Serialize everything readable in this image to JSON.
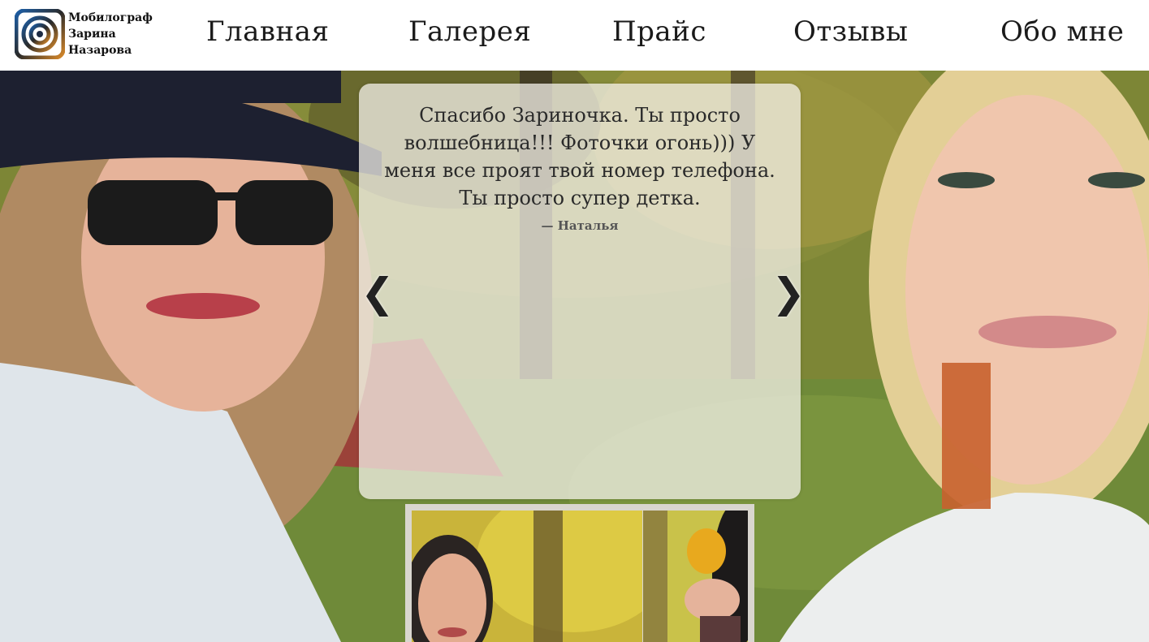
{
  "logo": {
    "line1": "Мобилограф",
    "line2": "Зарина",
    "line3": "Назарова",
    "icon": "concentric-rings-logo-icon"
  },
  "nav": {
    "items": [
      {
        "label": "Главная"
      },
      {
        "label": "Галерея"
      },
      {
        "label": "Прайс"
      },
      {
        "label": "Отзывы"
      },
      {
        "label": "Обо мне"
      }
    ]
  },
  "testimonial": {
    "quote": "Спасибо Зариночка. Ты просто волшебница!!! Фоточки огонь))) У меня все проят твой номер телефона. Ты просто супер детка.",
    "author": "— Наталья",
    "prev_icon": "chevron-left-icon",
    "prev_label": "❮",
    "next_icon": "chevron-right-icon",
    "next_label": "❯"
  },
  "colors": {
    "header_bg": "#ffffff",
    "nav_text": "#1a1a1a",
    "card_bg": "rgba(245,243,236,0.74)"
  }
}
